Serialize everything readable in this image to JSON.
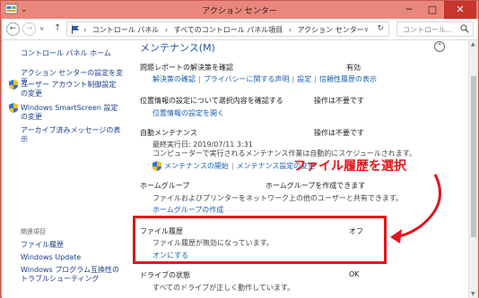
{
  "window": {
    "title": "アクション センター",
    "min_symbol": "─",
    "max_symbol": "□",
    "close_symbol": "✕",
    "qbar_symbol": "⌄"
  },
  "address": {
    "back_symbol": "←",
    "forward_symbol": "→",
    "dropdown_symbol": "∨",
    "up_symbol": "↑",
    "breadcrumbs": [
      "›",
      "コントロール パネル",
      "›",
      "すべてのコントロール パネル項目",
      "›",
      "アクション センター"
    ],
    "path_dropdown_symbol": "∨",
    "refresh_symbol": "↻",
    "search_placeholder": "コントロール..."
  },
  "sidebar": {
    "home": "コントロール パネル ホーム",
    "items": [
      "アクション センターの設定を変更",
      "ユーザー アカウント制御設定の変更",
      "Windows SmartScreen 設定の変更",
      "アーカイブ済みメッセージの表示"
    ],
    "related_header": "関連項目",
    "related": [
      "ファイル履歴",
      "Windows Update",
      "Windows プログラム互換性のトラブルシューティング"
    ]
  },
  "main": {
    "section_title": "メンテナンス(M)",
    "collapse_symbol": "⌃",
    "problem_reports": {
      "label": "問題レポートの解決策を確認",
      "status": "有効",
      "links": [
        "解決策の確認",
        "プライバシーに関する声明",
        "設定",
        "信頼性履歴の表示"
      ]
    },
    "location": {
      "label": "位置情報の設定について選択内容を確認する",
      "status": "操作は不要です",
      "link": "位置情報の設定を開く"
    },
    "auto_maintenance": {
      "label": "自動メンテナンス",
      "status": "操作は不要です",
      "last_run": "最終実行日: 2019/07/11 3:31",
      "desc": "コンピューターで実行されるメンテナンス作業は自動的にスケジュールされます。",
      "links": [
        "メンテナンスの開始",
        "メンテナンス設定の変更"
      ]
    },
    "homegroup": {
      "label": "ホームグループ",
      "status": "ホームグループを作成できます",
      "desc": "ファイルおよびプリンターをネットワーク上の他のユーザーと共有できます。",
      "link": "ホームグループの作成"
    },
    "file_history": {
      "label": "ファイル履歴",
      "status": "オフ",
      "desc": "ファイル履歴が無効になっています。",
      "link": "オンにする"
    },
    "drive_status": {
      "label": "ドライブの状態",
      "status": "OK",
      "desc": "すべてのドライブが正しく動作しています。"
    }
  },
  "annotation": {
    "text": "ファイル履歴を選択",
    "color": "#e4141b"
  },
  "colors": {
    "title_bg": "#e9877c",
    "close_bg": "#c7352c",
    "link": "#1a5fb0",
    "section_title": "#2255aa"
  }
}
